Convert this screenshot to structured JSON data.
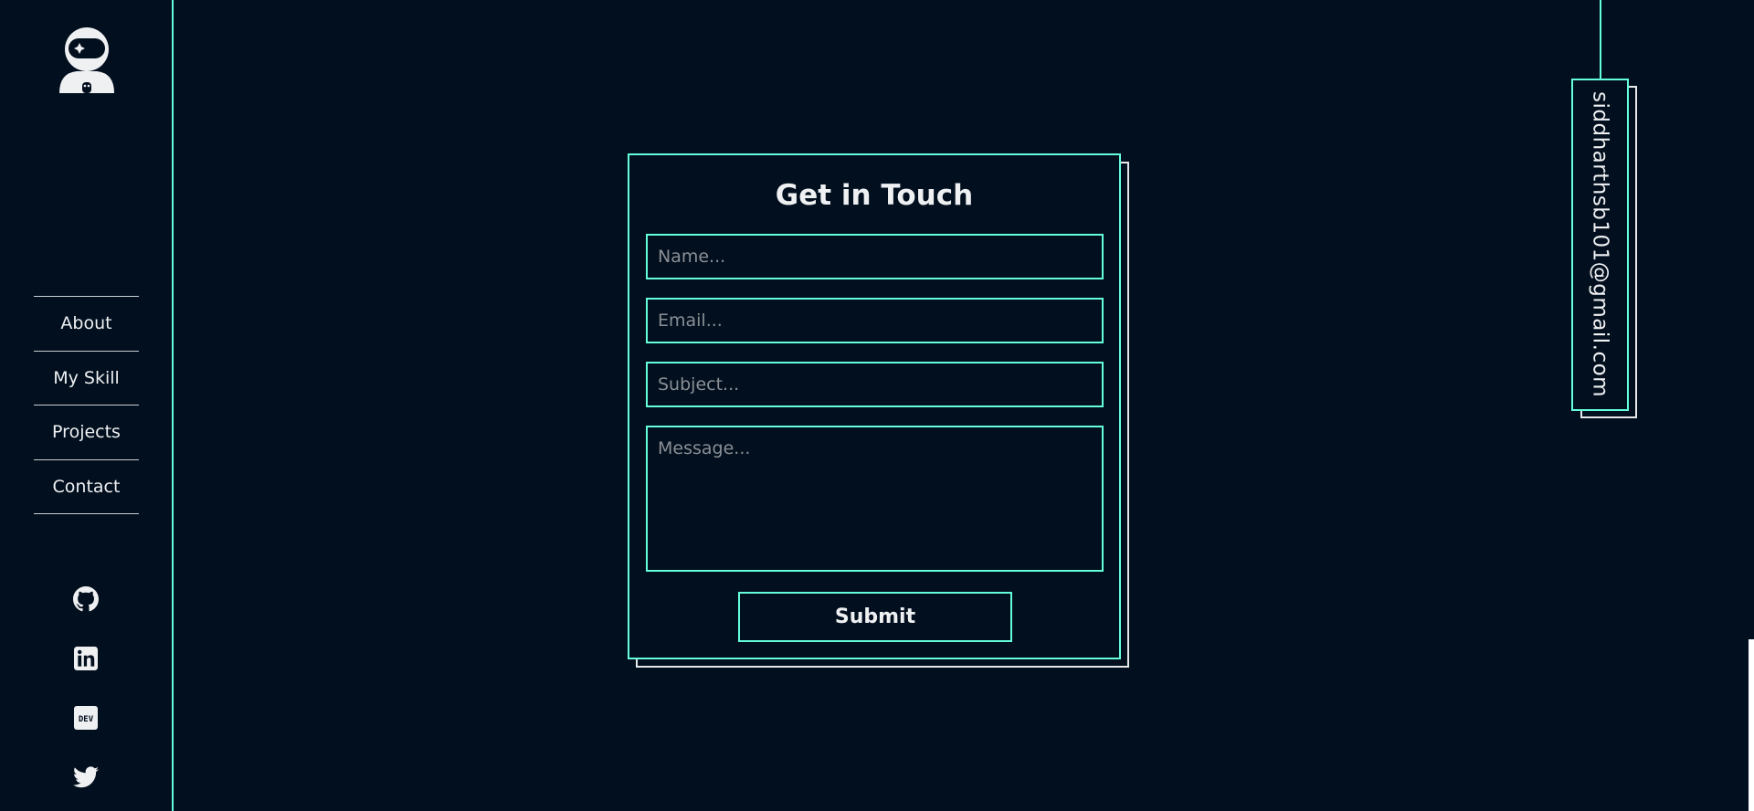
{
  "sidebar": {
    "logo_icon": "astronaut-logo-icon",
    "nav_items": [
      {
        "label": "About"
      },
      {
        "label": "My Skill"
      },
      {
        "label": "Projects"
      },
      {
        "label": "Contact"
      }
    ],
    "social_icons": [
      "github-icon",
      "linkedin-icon",
      "dev-icon",
      "twitter-icon"
    ]
  },
  "contact_form": {
    "title": "Get in Touch",
    "name_placeholder": "Name...",
    "email_placeholder": "Email...",
    "subject_placeholder": "Subject...",
    "message_placeholder": "Message...",
    "submit_label": "Submit"
  },
  "email_tag": {
    "address": "siddharthsb101@gmail.com"
  },
  "colors": {
    "background": "#020f1e",
    "accent": "#64ffda",
    "text": "#eef0f2"
  }
}
